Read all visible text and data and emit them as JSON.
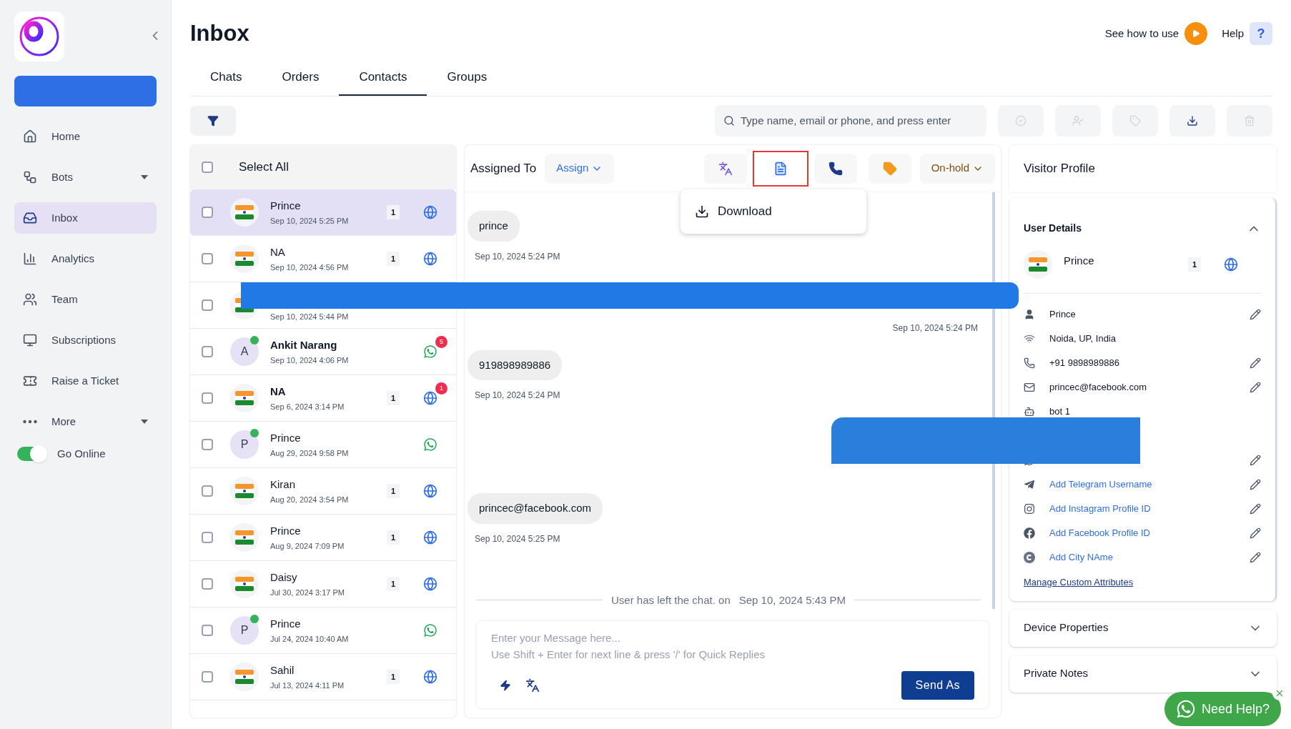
{
  "page": {
    "title": "Inbox",
    "see_how": "See how to use",
    "help": "Help",
    "help_mark": "?"
  },
  "sidebar": {
    "items": [
      {
        "label": "Home",
        "selected": false
      },
      {
        "label": "Bots",
        "selected": false,
        "has_menu": true
      },
      {
        "label": "Inbox",
        "selected": true
      },
      {
        "label": "Analytics",
        "selected": false
      },
      {
        "label": "Team",
        "selected": false
      },
      {
        "label": "Subscriptions",
        "selected": false
      },
      {
        "label": "Raise a Ticket",
        "selected": false
      },
      {
        "label": "More",
        "selected": false,
        "has_menu": true
      }
    ],
    "online_toggle": {
      "label": "Go Online",
      "on": true
    }
  },
  "tabs": [
    {
      "label": "Chats",
      "selected": false
    },
    {
      "label": "Orders",
      "selected": false
    },
    {
      "label": "Contacts",
      "selected": true
    },
    {
      "label": "Groups",
      "selected": false
    }
  ],
  "search": {
    "placeholder": "Type name, email or phone, and press enter"
  },
  "contacts": {
    "select_all": {
      "label": "Select All",
      "checked": false
    },
    "rows": [
      {
        "name": "Prince",
        "time": "Sep 10, 2024 5:25 PM",
        "avatar": {
          "kind": "flag"
        },
        "count": "1",
        "channel": {
          "kind": "web"
        },
        "selected": true,
        "checked": false
      },
      {
        "name": "NA",
        "time": "Sep 10, 2024 4:56 PM",
        "avatar": {
          "kind": "flag"
        },
        "count": "1",
        "channel": {
          "kind": "web"
        },
        "selected": false,
        "checked": false
      },
      {
        "time": "Sep 10, 2024 5:44 PM",
        "avatar": {
          "kind": "flag"
        },
        "selected": false,
        "checked": false
      },
      {
        "name": "Ankit Narang",
        "time": "Sep 10, 2024 4:06 PM",
        "avatar": {
          "kind": "letter",
          "letter": "A",
          "online": true
        },
        "channel": {
          "kind": "whatsapp"
        },
        "unread": "5",
        "bold": true,
        "selected": false,
        "checked": false
      },
      {
        "name": "NA",
        "time": "Sep 6, 2024 3:14 PM",
        "avatar": {
          "kind": "flag"
        },
        "count": "1",
        "channel": {
          "kind": "web"
        },
        "unread": "1",
        "bold": true,
        "selected": false,
        "checked": false
      },
      {
        "name": "Prince",
        "time": "Aug 29, 2024 9:58 PM",
        "avatar": {
          "kind": "letter",
          "letter": "P",
          "online": true
        },
        "channel": {
          "kind": "whatsapp"
        },
        "selected": false,
        "checked": false
      },
      {
        "name": "Kiran",
        "time": "Aug 20, 2024 3:54 PM",
        "avatar": {
          "kind": "flag"
        },
        "count": "1",
        "channel": {
          "kind": "web"
        },
        "selected": false,
        "checked": false
      },
      {
        "name": "Prince",
        "time": "Aug 9, 2024 7:09 PM",
        "avatar": {
          "kind": "flag"
        },
        "count": "1",
        "channel": {
          "kind": "web"
        },
        "selected": false,
        "checked": false
      },
      {
        "name": "Daisy",
        "time": "Jul 30, 2024 3:17 PM",
        "avatar": {
          "kind": "flag"
        },
        "count": "1",
        "channel": {
          "kind": "web"
        },
        "selected": false,
        "checked": false
      },
      {
        "name": "Prince",
        "time": "Jul 24, 2024 10:40 AM",
        "avatar": {
          "kind": "letter",
          "letter": "P",
          "online": true
        },
        "channel": {
          "kind": "whatsapp"
        },
        "selected": false,
        "checked": false
      },
      {
        "name": "Sahil",
        "time": "Jul 13, 2024 4:11 PM",
        "avatar": {
          "kind": "flag"
        },
        "count": "1",
        "channel": {
          "kind": "web"
        },
        "selected": false,
        "checked": false
      }
    ]
  },
  "chat": {
    "assigned_label": "Assigned To",
    "assign": "Assign",
    "status": "On-hold",
    "menu": {
      "item": "Download"
    },
    "messages": [
      {
        "kind": "incoming",
        "text": "prince",
        "time": "Sep 10, 2024 5:24 PM"
      },
      {
        "kind": "outgoing",
        "time": "Sep 10, 2024 5:24 PM"
      },
      {
        "kind": "incoming",
        "text": "919898989886",
        "time": "Sep 10, 2024 5:24 PM"
      },
      {
        "kind": "incoming",
        "text": "princec@facebook.com",
        "time": "Sep 10, 2024 5:25 PM"
      },
      {
        "kind": "event",
        "text": "User has left the chat. on",
        "time": "Sep 10, 2024 5:43 PM"
      }
    ],
    "composer": {
      "placeholder": "Enter your Message here...",
      "hint": "Use Shift + Enter for next line & press '/' for Quick Replies",
      "send": "Send As"
    }
  },
  "profile": {
    "title": "Visitor Profile",
    "user_details": {
      "title": "User Details",
      "expanded": true,
      "name": "Prince",
      "count": "1",
      "fields": [
        {
          "kind": "text",
          "value": "Prince",
          "editable": true
        },
        {
          "kind": "text",
          "value": "Noida, UP, India"
        },
        {
          "kind": "text",
          "value": "+91 9898989886",
          "editable": true
        },
        {
          "kind": "text",
          "value": "princec@facebook.com",
          "editable": true
        },
        {
          "kind": "text",
          "value": "bot 1"
        },
        {
          "kind": "hidden",
          "editable": true
        },
        {
          "kind": "link",
          "value": "Add Telegram Username",
          "editable": true
        },
        {
          "kind": "link",
          "value": "Add Instagram Profile ID",
          "editable": true
        },
        {
          "kind": "link",
          "value": "Add Facebook Profile ID",
          "editable": true
        },
        {
          "kind": "link",
          "value": "Add City NAme",
          "editable": true
        }
      ],
      "manage": "Manage Custom Attributes"
    },
    "sections": [
      {
        "title": "Device Properties",
        "expanded": false
      },
      {
        "title": "Private Notes",
        "expanded": false
      }
    ]
  },
  "help_widget": {
    "label": "Need Help?"
  }
}
